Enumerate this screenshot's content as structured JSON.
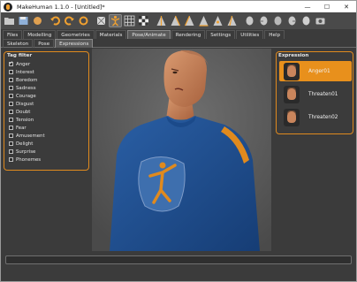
{
  "window": {
    "title": "MakeHuman 1.1.0 - [Untitled]*",
    "minimize": "—",
    "maximize": "☐",
    "close": "✕"
  },
  "toolbar": {
    "icons": [
      "folder-icon",
      "save-icon",
      "export-icon",
      "undo-icon",
      "redo-icon",
      "reset-icon",
      "wireframe-icon",
      "pose-icon",
      "grid-icon",
      "checker-icon",
      "front-view-icon",
      "back-view-icon",
      "left-view-icon",
      "right-view-icon",
      "top-view-icon",
      "bottom-view-icon",
      "head-front-icon",
      "head-side-icon",
      "head-back-icon",
      "head-top-icon",
      "smooth-icon",
      "camera-icon"
    ]
  },
  "tabs": {
    "main": [
      "Files",
      "Modelling",
      "Geometries",
      "Materials",
      "Pose/Animate",
      "Rendering",
      "Settings",
      "Utilities",
      "Help"
    ],
    "active_main": "Pose/Animate",
    "sub": [
      "Skeleton",
      "Pose",
      "Expressions"
    ],
    "active_sub": "Expressions"
  },
  "tag_filter": {
    "title": "Tag filter",
    "tags": [
      {
        "label": "Anger",
        "checked": true
      },
      {
        "label": "Interest",
        "checked": false
      },
      {
        "label": "Boredom",
        "checked": false
      },
      {
        "label": "Sadness",
        "checked": false
      },
      {
        "label": "Courage",
        "checked": false
      },
      {
        "label": "Disgust",
        "checked": false
      },
      {
        "label": "Doubt",
        "checked": false
      },
      {
        "label": "Tension",
        "checked": false
      },
      {
        "label": "Fear",
        "checked": false
      },
      {
        "label": "Amusement",
        "checked": false
      },
      {
        "label": "Delight",
        "checked": false
      },
      {
        "label": "Surprise",
        "checked": false
      },
      {
        "label": "Phonemes",
        "checked": false
      }
    ]
  },
  "expression": {
    "title": "Expression",
    "items": [
      {
        "label": "Anger01",
        "selected": true
      },
      {
        "label": "Threaten01",
        "selected": false
      },
      {
        "label": "Threaten02",
        "selected": false
      }
    ]
  },
  "colors": {
    "accent": "#e8901c",
    "shirt": "#1f4f8f",
    "background": "#3b3b3b"
  }
}
